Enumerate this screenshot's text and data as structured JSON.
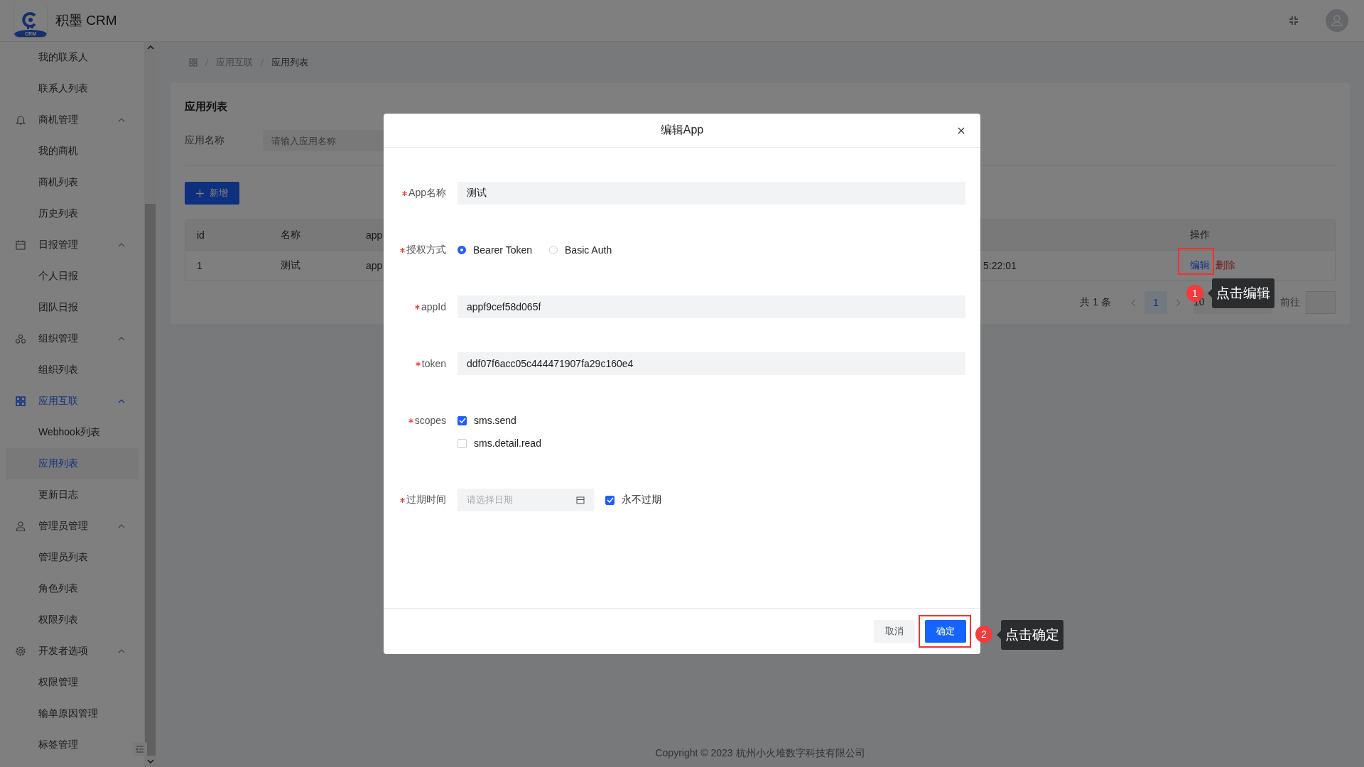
{
  "app": {
    "logo_badge": "CRM",
    "name": "积墨 CRM"
  },
  "sidebar": {
    "items": [
      {
        "kind": "item",
        "label": "我的联系人",
        "selected": false
      },
      {
        "kind": "item",
        "label": "联系人列表",
        "selected": false
      },
      {
        "kind": "group",
        "label": "商机管理",
        "expanded": true,
        "children": [
          {
            "label": "我的商机",
            "selected": false
          },
          {
            "label": "商机列表",
            "selected": false
          },
          {
            "label": "历史列表",
            "selected": false
          }
        ]
      },
      {
        "kind": "group",
        "label": "日报管理",
        "expanded": true,
        "children": [
          {
            "label": "个人日报",
            "selected": false
          },
          {
            "label": "团队日报",
            "selected": false
          }
        ]
      },
      {
        "kind": "group",
        "label": "组织管理",
        "expanded": true,
        "children": [
          {
            "label": "组织列表",
            "selected": false
          }
        ]
      },
      {
        "kind": "group",
        "label": "应用互联",
        "expanded": true,
        "children": [
          {
            "label": "Webhook列表",
            "selected": false
          },
          {
            "label": "应用列表",
            "selected": true
          },
          {
            "label": "更新日志",
            "selected": false
          }
        ]
      },
      {
        "kind": "group",
        "label": "管理员管理",
        "expanded": true,
        "children": [
          {
            "label": "管理员列表",
            "selected": false
          },
          {
            "label": "角色列表",
            "selected": false
          },
          {
            "label": "权限列表",
            "selected": false
          }
        ]
      },
      {
        "kind": "group",
        "label": "开发者选项",
        "expanded": true,
        "children": [
          {
            "label": "权限管理",
            "selected": false
          },
          {
            "label": "输单原因管理",
            "selected": false
          },
          {
            "label": "标签管理",
            "selected": false
          }
        ]
      }
    ]
  },
  "breadcrumb": [
    "应用互联",
    "应用列表"
  ],
  "page": {
    "title": "应用列表",
    "search": {
      "label": "应用名称",
      "placeholder": "请输入应用名称"
    },
    "add_button": "新增",
    "table": {
      "columns": [
        "id",
        "名称",
        "app"
      ],
      "actions_header": "操作",
      "rows": [
        {
          "cells": [
            "1",
            "测试",
            "app",
            "5:22:01"
          ],
          "actions": [
            {
              "label": "编辑",
              "kind": "edit"
            },
            {
              "label": "删除",
              "kind": "delete"
            }
          ]
        }
      ]
    },
    "pagination": {
      "total": "共 1 条",
      "pages": [
        {
          "label": "1",
          "selected": true
        }
      ],
      "page_size": "10",
      "jump_label": "前往"
    }
  },
  "dialog": {
    "title": "编辑App",
    "fields": [
      {
        "kind": "text",
        "label": "App名称",
        "required": true,
        "value": "测试"
      },
      {
        "kind": "radio",
        "label": "授权方式",
        "required": true,
        "options": [
          {
            "label": "Bearer Token",
            "selected": true
          },
          {
            "label": "Basic Auth",
            "selected": false
          }
        ]
      },
      {
        "kind": "text",
        "label": "appId",
        "required": true,
        "value": "appf9cef58d065f"
      },
      {
        "kind": "text",
        "label": "token",
        "required": true,
        "value": "ddf07f6acc05c444471907fa29c160e4"
      },
      {
        "kind": "checkboxes",
        "label": "scopes",
        "required": true,
        "options": [
          {
            "label": "sms.send",
            "checked": true
          },
          {
            "label": "sms.detail.read",
            "checked": false
          }
        ]
      },
      {
        "kind": "date",
        "label": "过期时间",
        "required": true,
        "placeholder": "请选择日期",
        "extra": {
          "label": "永不过期",
          "checked": true
        }
      }
    ],
    "buttons": [
      {
        "label": "取消",
        "kind": "secondary"
      },
      {
        "label": "确定",
        "kind": "primary"
      }
    ]
  },
  "guides": [
    {
      "number": "1",
      "text": "点击编辑"
    },
    {
      "number": "2",
      "text": "点击确定"
    }
  ],
  "footer": {
    "copyright": "Copyright © 2023 杭州小火堆数字科技有限公司"
  }
}
